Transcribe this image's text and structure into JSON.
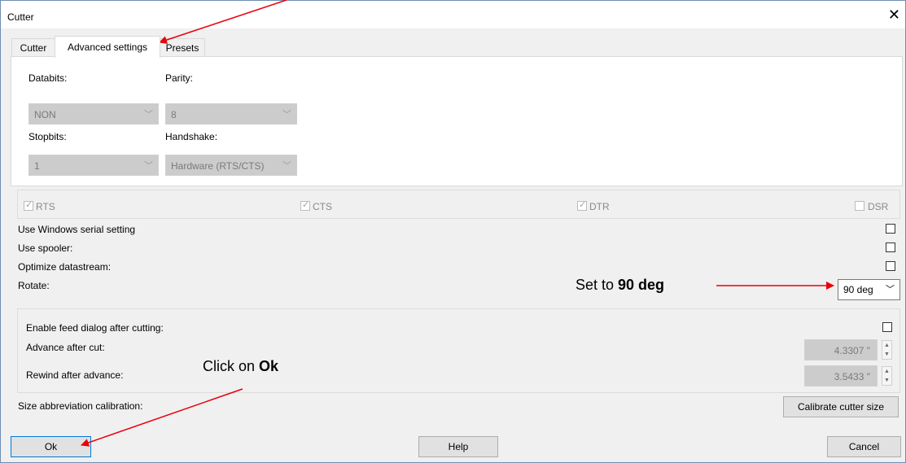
{
  "window": {
    "title": "Cutter"
  },
  "tabs": [
    "Cutter",
    "Advanced settings",
    "Presets"
  ],
  "serial": {
    "databits_label": "Databits:",
    "databits_value": "NON",
    "parity_label": "Parity:",
    "parity_value": "8",
    "stopbits_label": "Stopbits:",
    "stopbits_value": "1",
    "handshake_label": "Handshake:",
    "handshake_value": "Hardware (RTS/CTS)"
  },
  "signals": [
    {
      "label": "RTS",
      "checked": true
    },
    {
      "label": "CTS",
      "checked": true
    },
    {
      "label": "DTR",
      "checked": true
    },
    {
      "label": "DSR",
      "checked": false
    }
  ],
  "options": {
    "windows_serial_label": "Use Windows serial setting",
    "spooler_label": "Use spooler:",
    "optimize_label": "Optimize datastream:",
    "rotate_label": "Rotate:",
    "rotate_value": "90 deg"
  },
  "feed": {
    "enable_label": "Enable feed dialog after cutting:",
    "advance_label": "Advance after cut:",
    "advance_value": "4.3307 \"",
    "rewind_label": "Rewind after advance:",
    "rewind_value": "3.5433 \""
  },
  "calibration": {
    "label": "Size abbreviation calibration:",
    "button": "Calibrate cutter size"
  },
  "buttons": {
    "ok": "Ok",
    "help": "Help",
    "cancel": "Cancel"
  },
  "annotations": {
    "rotate_prefix": "Set to ",
    "rotate_bold": "90 deg",
    "ok_prefix": "Click on ",
    "ok_bold": "Ok"
  },
  "colors": {
    "arrow": "#e8000b",
    "dialog_border": "#6e8db3",
    "default_button_border": "#0078d7"
  }
}
